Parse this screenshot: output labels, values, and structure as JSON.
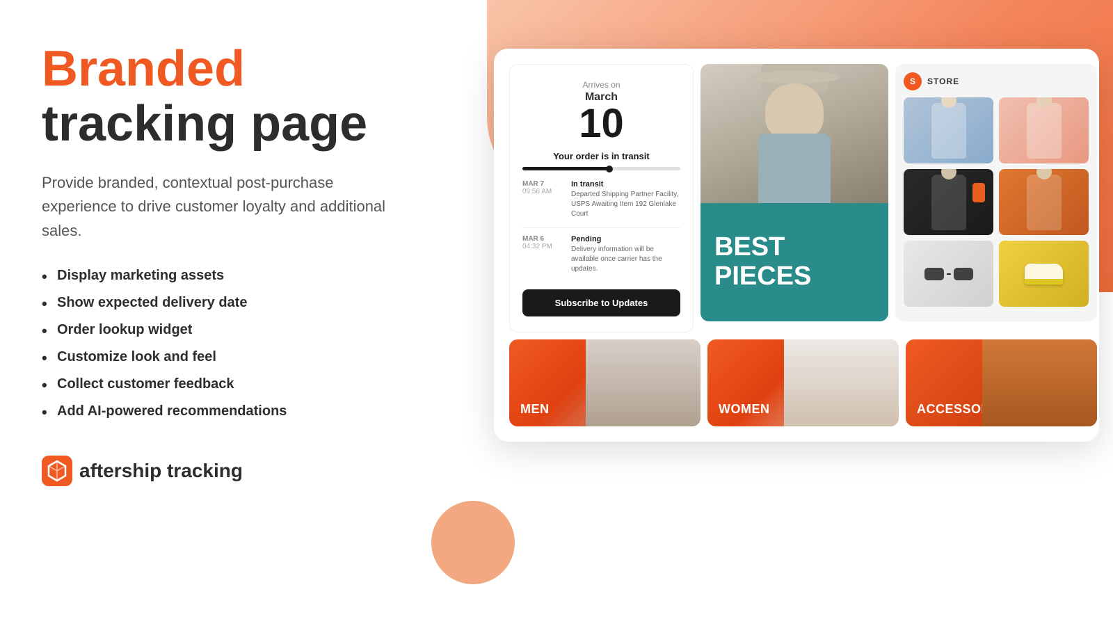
{
  "page": {
    "background": "#ffffff"
  },
  "left": {
    "headline_branded": "Branded",
    "headline_tracking": "tracking page",
    "description": "Provide branded, contextual post-purchase experience to drive customer loyalty and additional sales.",
    "features": [
      "Display marketing assets",
      "Show expected delivery date",
      "Order lookup widget",
      "Customize look and feel",
      "Collect customer feedback",
      "Add AI-powered recommendations"
    ],
    "logo_name": "aftership",
    "logo_suffix": "tracking"
  },
  "tracking": {
    "arrives_label": "Arrives on",
    "arrives_month": "March",
    "arrives_day": "10",
    "status": "Your order is in transit",
    "events": [
      {
        "date": "MAR 7",
        "time": "09:56 AM",
        "status": "In transit",
        "detail": "Departed Shipping Partner Facility, USPS Awaiting Item 192 Glenlake Court"
      },
      {
        "date": "MAR 6",
        "time": "04:32 PM",
        "status": "Pending",
        "detail": "Delivery information will be available once carrier has the updates."
      }
    ],
    "subscribe_button": "Subscribe to Updates"
  },
  "best_pieces": {
    "text_line1": "BEST",
    "text_line2": "PIECES"
  },
  "store": {
    "icon_letter": "S",
    "label": "STORE",
    "items": [
      {
        "color": "jacket-blue"
      },
      {
        "color": "jacket-pink"
      },
      {
        "color": "jacket-dark"
      },
      {
        "color": "jacket-orange"
      },
      {
        "color": "sunglasses"
      },
      {
        "color": "yellow"
      }
    ]
  },
  "categories": [
    {
      "label": "MEN",
      "key": "men"
    },
    {
      "label": "WOMEN",
      "key": "women"
    },
    {
      "label": "ACCESSORIES",
      "key": "accessories"
    }
  ]
}
